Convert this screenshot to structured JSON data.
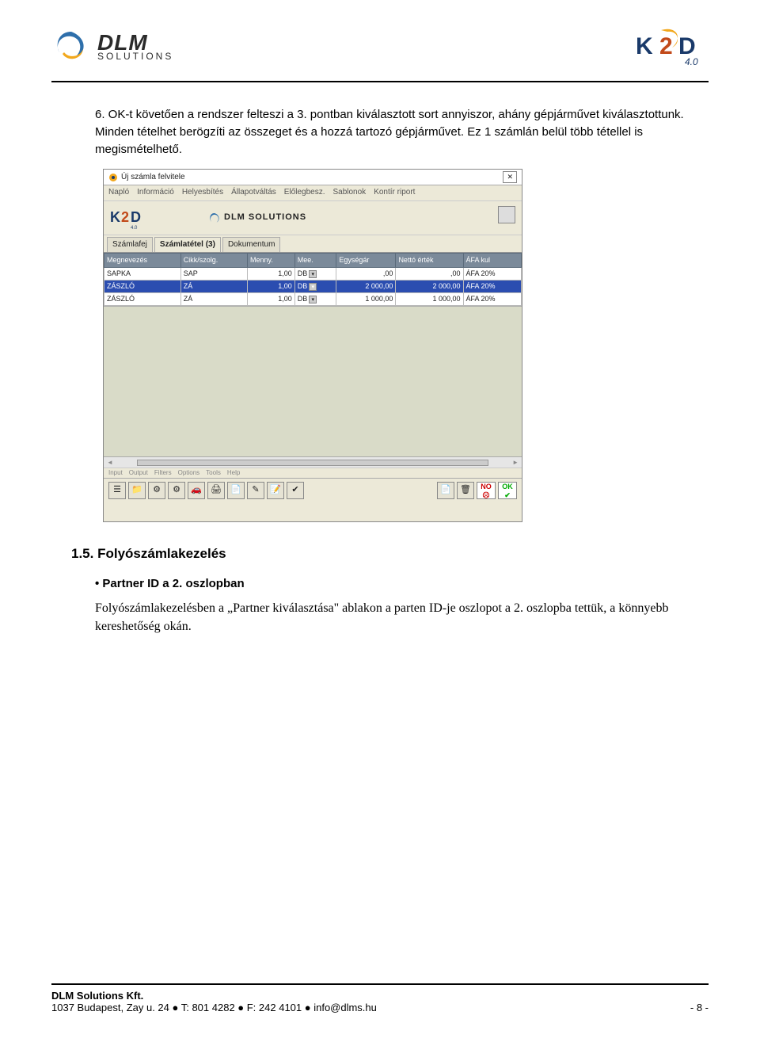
{
  "header": {
    "brand": "DLM",
    "sub": "SOLUTIONS",
    "right_brand": "K2D",
    "right_sub": "4.0"
  },
  "content": {
    "para6": "6. OK-t követően a rendszer felteszi a 3. pontban kiválasztott sort annyiszor, ahány gépjárművet kiválasztottunk. Minden tételhet berögzíti az összeget és a hozzá tartozó gépjárművet. Ez 1 számlán belül több tétellel is megismételhető.",
    "h15": "1.5.   Folyószámlakezelés",
    "bullet": "Partner ID a 2. oszlopban",
    "bodytext": "Folyószámlakezelésben a „Partner kiválasztása\" ablakon a parten ID-je oszlopot a 2. oszlopba tettük, a könnyebb kereshetőség okán."
  },
  "screenshot": {
    "title": "Új számla felvitele",
    "menu": [
      "Napló",
      "Információ",
      "Helyesbítés",
      "Állapotváltás",
      "Előlegbesz.",
      "Sablonok",
      "Kontír riport"
    ],
    "brand1": "K2D",
    "brand1sub": "4.0",
    "brand2": "DLM SOLUTIONS",
    "tabs": [
      {
        "label": "Számlafej",
        "active": false
      },
      {
        "label": "Számlatétel (3)",
        "active": true
      },
      {
        "label": "Dokumentum",
        "active": false
      }
    ],
    "columns": [
      "Megnevezés",
      "Cikk/szolg.",
      "Menny.",
      "Mee.",
      "Egységár",
      "Nettó érték",
      "ÁFA kul"
    ],
    "rows": [
      {
        "sel": false,
        "c": [
          "SAPKA",
          "SAP",
          "1,00",
          "DB",
          ",00",
          ",00",
          "ÁFA 20%"
        ]
      },
      {
        "sel": true,
        "c": [
          "ZÁSZLÓ",
          "ZÁ",
          "1,00",
          "DB",
          "2 000,00",
          "2 000,00",
          "ÁFA 20%"
        ]
      },
      {
        "sel": false,
        "c": [
          "ZÁSZLÓ",
          "ZÁ",
          "1,00",
          "DB",
          "1 000,00",
          "1 000,00",
          "ÁFA 20%"
        ]
      }
    ],
    "submenu": [
      "Input",
      "Output",
      "Filters",
      "Options",
      "Tools",
      "Help"
    ],
    "noLabel": "NO",
    "okLabel": "OK"
  },
  "footer": {
    "company": "DLM Solutions Kft.",
    "address": "1037 Budapest, Zay u. 24  ●  T: 801 4282  ●  F: 242 4101  ●  info@dlms.hu",
    "page": "- 8 -"
  }
}
